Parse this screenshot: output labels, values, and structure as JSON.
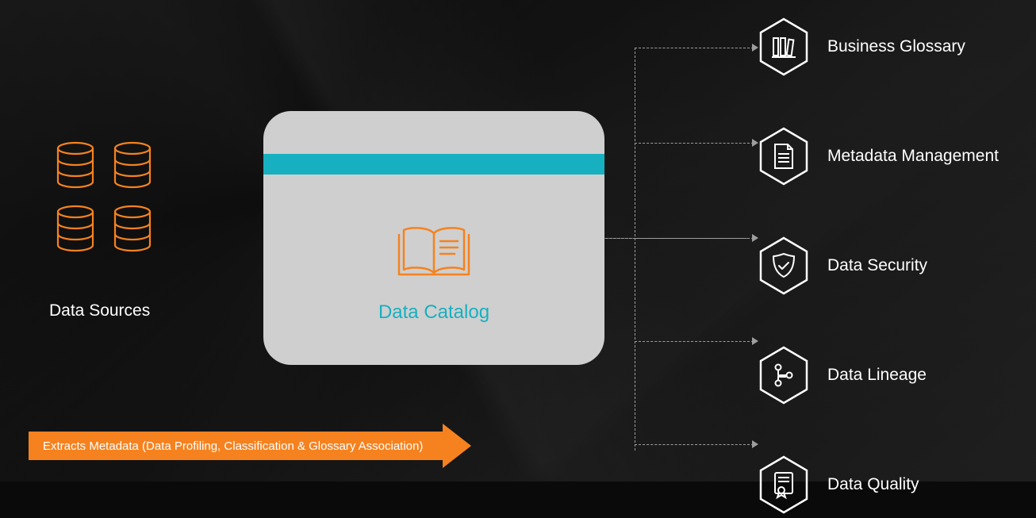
{
  "sources_label": "Data Sources",
  "catalog_label": "Data Catalog",
  "features": [
    {
      "label": "Business Glossary"
    },
    {
      "label": "Metadata Management"
    },
    {
      "label": "Data Security"
    },
    {
      "label": "Data Lineage"
    },
    {
      "label": "Data Quality"
    }
  ],
  "arrow_text": "Extracts Metadata (Data Profiling, Classification & Glossary Association)"
}
